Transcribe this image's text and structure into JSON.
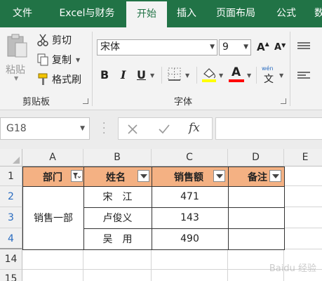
{
  "tabs": [
    "文件",
    "Excel与财务",
    "开始",
    "插入",
    "页面布局",
    "公式",
    "数"
  ],
  "active_tab": "开始",
  "clipboard": {
    "paste_label": "粘贴",
    "cut_label": "剪切",
    "copy_label": "复制",
    "format_painter_label": "格式刷",
    "group_label": "剪贴板"
  },
  "font": {
    "font_name": "宋体",
    "font_size": "9",
    "group_label": "字体",
    "bold": "B",
    "italic": "I",
    "underline": "U",
    "font_color_letter": "A",
    "phonetic_label": "wén",
    "phonetic_char": "文"
  },
  "formula_bar": {
    "name_box": "G18",
    "fx_label": "fx",
    "formula": ""
  },
  "columns": [
    "A",
    "B",
    "C",
    "D",
    "E"
  ],
  "rows": [
    "1",
    "2",
    "3",
    "4",
    "14",
    "15"
  ],
  "table": {
    "headers": [
      "部门",
      "姓名",
      "销售额",
      "备注"
    ],
    "department": "销售一部",
    "records": [
      {
        "name": "宋　江",
        "sales": "471"
      },
      {
        "name": "卢俊义",
        "sales": "143"
      },
      {
        "name": "吴　用",
        "sales": "490"
      }
    ]
  },
  "watermark": "Baidu 经验",
  "colors": {
    "ribbon_green": "#217346",
    "header_fill": "#f4b183",
    "highlight_yellow": "#ffff00",
    "font_red": "#ff0000"
  }
}
